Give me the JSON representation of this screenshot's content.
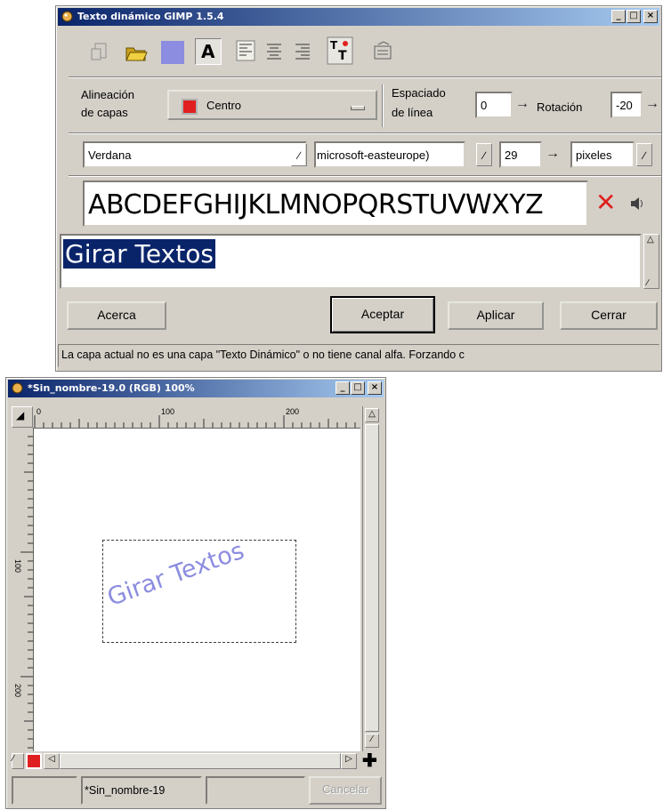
{
  "dialog": {
    "title": "Texto dinámico GIMP 1.5.4",
    "layer_align_label": "Alineación de capas",
    "layer_align_line1": "Alineación",
    "layer_align_line2": "de capas",
    "layer_align_value": "Centro",
    "line_spacing_line1": "Espaciado",
    "line_spacing_line2": "de línea",
    "line_spacing_value": "0",
    "rotation_label": "Rotación",
    "rotation_value": "-20",
    "font_family": "Verdana",
    "font_encoding": "microsoft-easteurope)",
    "font_size": "29",
    "font_unit": "pixeles",
    "font_preview": "ABCDEFGHIJKLMNOPQRSTUVWXYZ",
    "text_value": "Girar Textos",
    "buttons": {
      "about": "Acerca",
      "ok": "Aceptar",
      "apply": "Aplicar",
      "close": "Cerrar"
    },
    "status": "La capa actual no es una capa \"Texto Dinámico\" o no tiene canal alfa. Forzando c",
    "colors": {
      "swatch": "#8c8ce0",
      "selection_bg": "#0a246a",
      "title_start": "#0a246a",
      "title_end": "#a6caf0",
      "close_red": "#e02020"
    }
  },
  "image_window": {
    "title": "*Sin_nombre-19.0 (RGB) 100%",
    "ruler_labels": [
      "0",
      "100",
      "200"
    ],
    "vruler_labels": [
      "100",
      "200"
    ],
    "canvas_text": "Girar Textos",
    "canvas_text_color": "#8c8ce0",
    "status_name": "*Sin_nombre-19",
    "cancel_label": "Cancelar"
  }
}
